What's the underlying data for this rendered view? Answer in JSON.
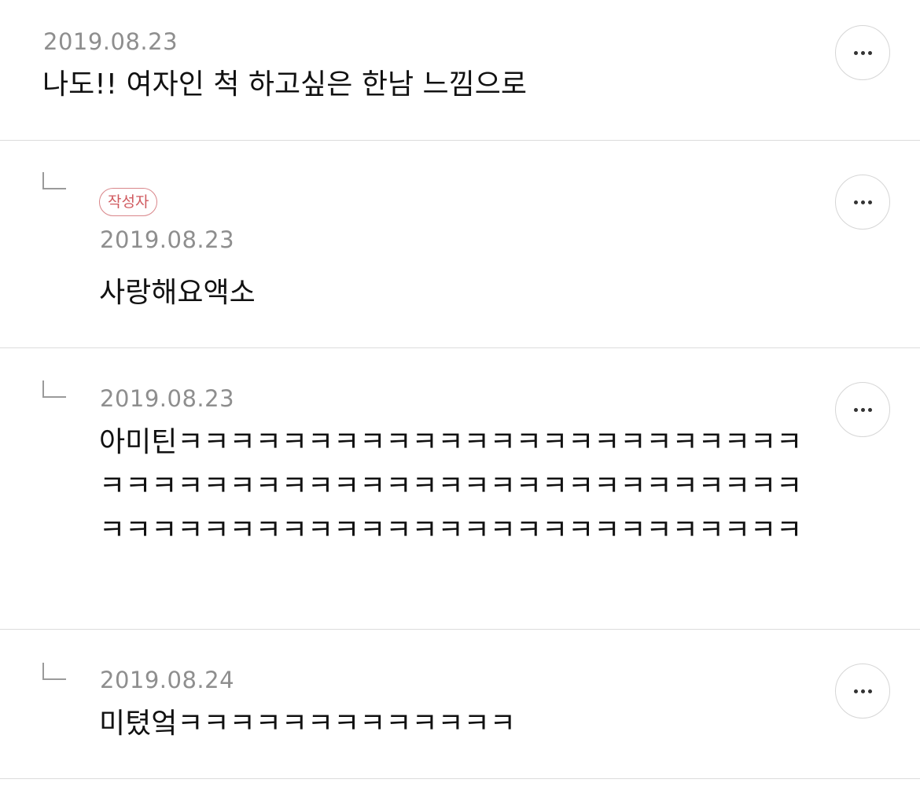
{
  "comments": [
    {
      "date": "2019.08.23",
      "text": "나도!! 여자인 척 하고싶은 한남 느낌으로"
    },
    {
      "badge": "작성자",
      "date": "2019.08.23",
      "text": "사랑해요액소"
    },
    {
      "date": "2019.08.23",
      "text": "아미틴ㅋㅋㅋㅋㅋㅋㅋㅋㅋㅋㅋㅋㅋㅋㅋㅋㅋㅋㅋㅋㅋㅋㅋㅋㅋㅋㅋㅋㅋㅋㅋㅋㅋㅋㅋㅋㅋㅋㅋㅋㅋㅋㅋㅋㅋㅋㅋㅋㅋㅋㅋㅋㅋㅋㅋㅋㅋㅋㅋㅋㅋㅋㅋㅋㅋㅋㅋㅋㅋㅋㅋㅋㅋㅋㅋㅋㅋㅋ"
    },
    {
      "date": "2019.08.24",
      "text": "미텼엌ㅋㅋㅋㅋㅋㅋㅋㅋㅋㅋㅋㅋㅋ"
    }
  ],
  "icons": {
    "reply": "reply-arrow-icon",
    "more": "more-options-icon"
  }
}
